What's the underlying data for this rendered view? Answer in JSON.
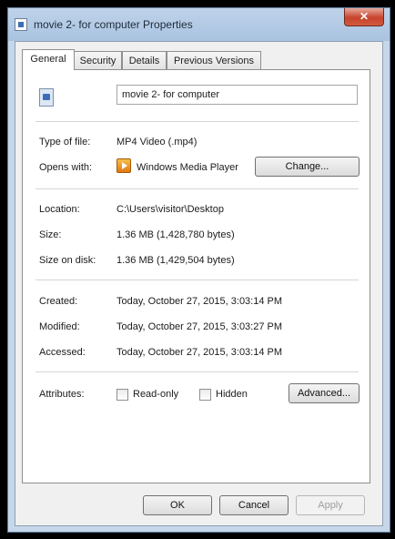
{
  "window": {
    "title": "movie 2- for computer Properties",
    "close_label": "✕"
  },
  "tabs": [
    {
      "label": "General",
      "active": true
    },
    {
      "label": "Security",
      "active": false
    },
    {
      "label": "Details",
      "active": false
    },
    {
      "label": "Previous Versions",
      "active": false
    }
  ],
  "general": {
    "file_name": "movie 2- for computer",
    "type_label": "Type of file:",
    "type_value": "MP4 Video (.mp4)",
    "opens_label": "Opens with:",
    "opens_value": "Windows Media Player",
    "change_button": "Change...",
    "location_label": "Location:",
    "location_value": "C:\\Users\\visitor\\Desktop",
    "size_label": "Size:",
    "size_value": "1.36 MB (1,428,780 bytes)",
    "size_on_disk_label": "Size on disk:",
    "size_on_disk_value": "1.36 MB (1,429,504 bytes)",
    "created_label": "Created:",
    "created_value": "Today, October 27, 2015, 3:03:14 PM",
    "modified_label": "Modified:",
    "modified_value": "Today, October 27, 2015, 3:03:27 PM",
    "accessed_label": "Accessed:",
    "accessed_value": "Today, October 27, 2015, 3:03:14 PM",
    "attributes_label": "Attributes:",
    "readonly_label": "Read-only",
    "hidden_label": "Hidden",
    "advanced_button": "Advanced..."
  },
  "footer": {
    "ok": "OK",
    "cancel": "Cancel",
    "apply": "Apply"
  },
  "icons": {
    "app": "document-icon",
    "file": "video-file-icon",
    "player": "windows-media-player-icon"
  }
}
